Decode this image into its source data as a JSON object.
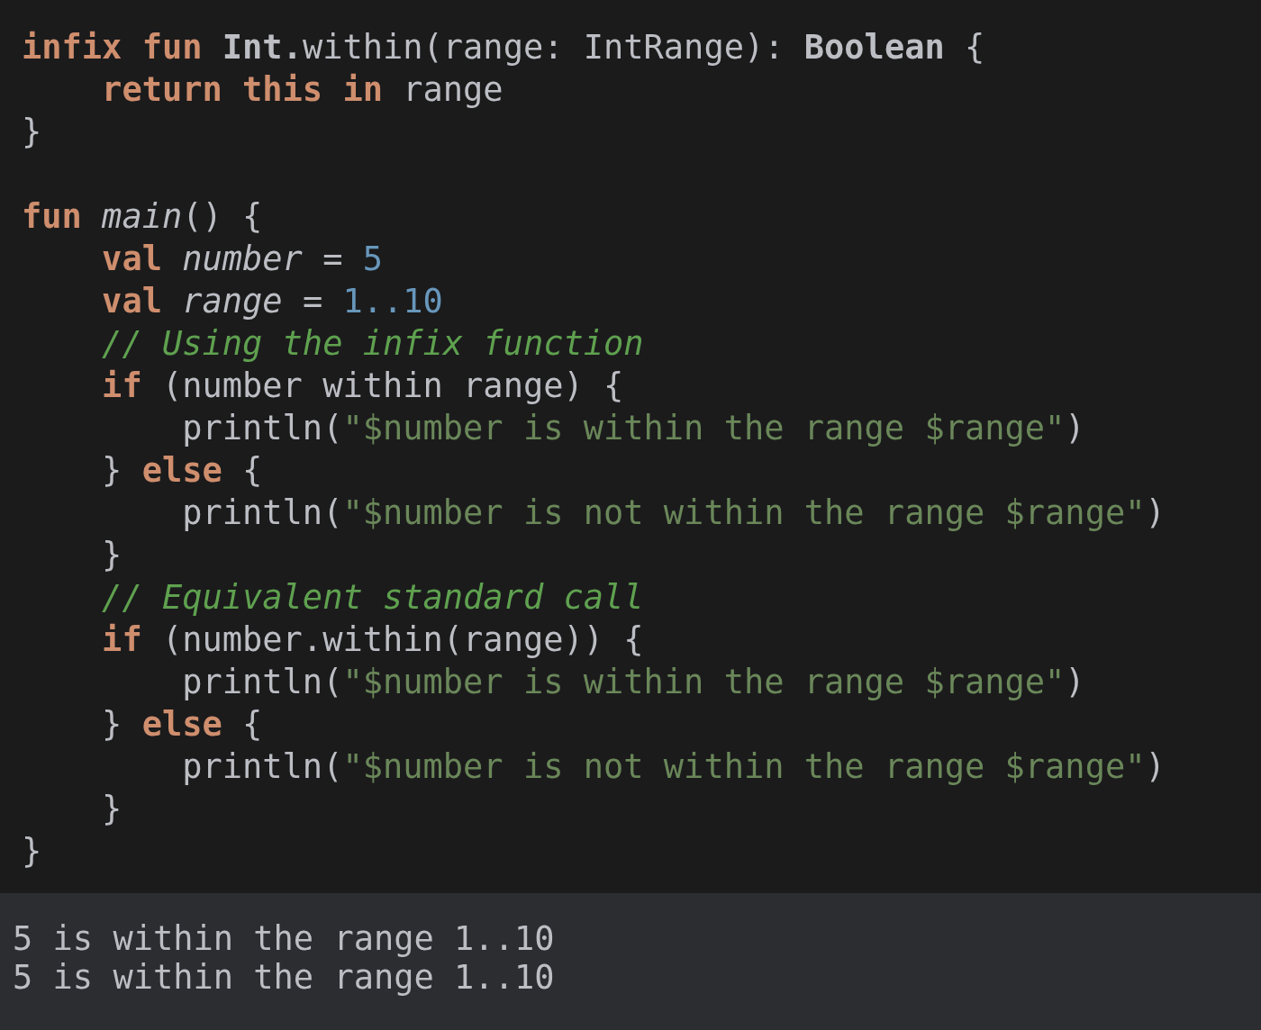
{
  "editor": {
    "lines": [
      {
        "kind": "code",
        "tokens": [
          {
            "kind": "keyword",
            "text": "infix fun "
          },
          {
            "kind": "type",
            "text": "Int."
          },
          {
            "kind": "plain",
            "text": "within(range: IntRange): "
          },
          {
            "kind": "type",
            "text": "Boolean"
          },
          {
            "kind": "plain",
            "text": " {"
          }
        ]
      },
      {
        "kind": "code",
        "tokens": [
          {
            "kind": "keyword",
            "text": "    return this in "
          },
          {
            "kind": "plain",
            "text": "range"
          }
        ]
      },
      {
        "kind": "code",
        "tokens": [
          {
            "kind": "plain",
            "text": "}"
          }
        ]
      },
      {
        "kind": "blank"
      },
      {
        "kind": "code",
        "tokens": [
          {
            "kind": "keyword",
            "text": "fun "
          },
          {
            "kind": "italic",
            "text": "main"
          },
          {
            "kind": "plain",
            "text": "() {"
          }
        ]
      },
      {
        "kind": "code",
        "tokens": [
          {
            "kind": "keyword",
            "text": "    val "
          },
          {
            "kind": "italic",
            "text": "number"
          },
          {
            "kind": "plain",
            "text": " = "
          },
          {
            "kind": "number",
            "text": "5"
          }
        ]
      },
      {
        "kind": "code",
        "tokens": [
          {
            "kind": "keyword",
            "text": "    val "
          },
          {
            "kind": "italic",
            "text": "range"
          },
          {
            "kind": "plain",
            "text": " = "
          },
          {
            "kind": "number",
            "text": "1..10"
          }
        ]
      },
      {
        "kind": "code",
        "tokens": [
          {
            "kind": "comment",
            "text": "    // Using the infix function"
          }
        ]
      },
      {
        "kind": "code",
        "tokens": [
          {
            "kind": "keyword",
            "text": "    if "
          },
          {
            "kind": "plain",
            "text": "(number within range) {"
          }
        ]
      },
      {
        "kind": "code",
        "tokens": [
          {
            "kind": "plain",
            "text": "        println("
          },
          {
            "kind": "string",
            "text": "\"$number is within the range $range\""
          },
          {
            "kind": "plain",
            "text": ")"
          }
        ]
      },
      {
        "kind": "code",
        "tokens": [
          {
            "kind": "plain",
            "text": "    } "
          },
          {
            "kind": "keyword",
            "text": "else"
          },
          {
            "kind": "plain",
            "text": " {"
          }
        ]
      },
      {
        "kind": "code",
        "tokens": [
          {
            "kind": "plain",
            "text": "        println("
          },
          {
            "kind": "string",
            "text": "\"$number is not within the range $range\""
          },
          {
            "kind": "plain",
            "text": ")"
          }
        ]
      },
      {
        "kind": "code",
        "tokens": [
          {
            "kind": "plain",
            "text": "    }"
          }
        ]
      },
      {
        "kind": "code",
        "tokens": [
          {
            "kind": "comment",
            "text": "    // Equivalent standard call"
          }
        ]
      },
      {
        "kind": "code",
        "tokens": [
          {
            "kind": "keyword",
            "text": "    if "
          },
          {
            "kind": "plain",
            "text": "(number.within(range)) {"
          }
        ]
      },
      {
        "kind": "code",
        "tokens": [
          {
            "kind": "plain",
            "text": "        println("
          },
          {
            "kind": "string",
            "text": "\"$number is within the range $range\""
          },
          {
            "kind": "plain",
            "text": ")"
          }
        ]
      },
      {
        "kind": "code",
        "tokens": [
          {
            "kind": "plain",
            "text": "    } "
          },
          {
            "kind": "keyword",
            "text": "else"
          },
          {
            "kind": "plain",
            "text": " {"
          }
        ]
      },
      {
        "kind": "code",
        "tokens": [
          {
            "kind": "plain",
            "text": "        println("
          },
          {
            "kind": "string",
            "text": "\"$number is not within the range $range\""
          },
          {
            "kind": "plain",
            "text": ")"
          }
        ]
      },
      {
        "kind": "code",
        "tokens": [
          {
            "kind": "plain",
            "text": "    }"
          }
        ]
      },
      {
        "kind": "code",
        "tokens": [
          {
            "kind": "plain",
            "text": "}"
          }
        ]
      }
    ]
  },
  "output": {
    "lines": [
      "5 is within the range 1..10",
      "5 is within the range 1..10"
    ]
  }
}
